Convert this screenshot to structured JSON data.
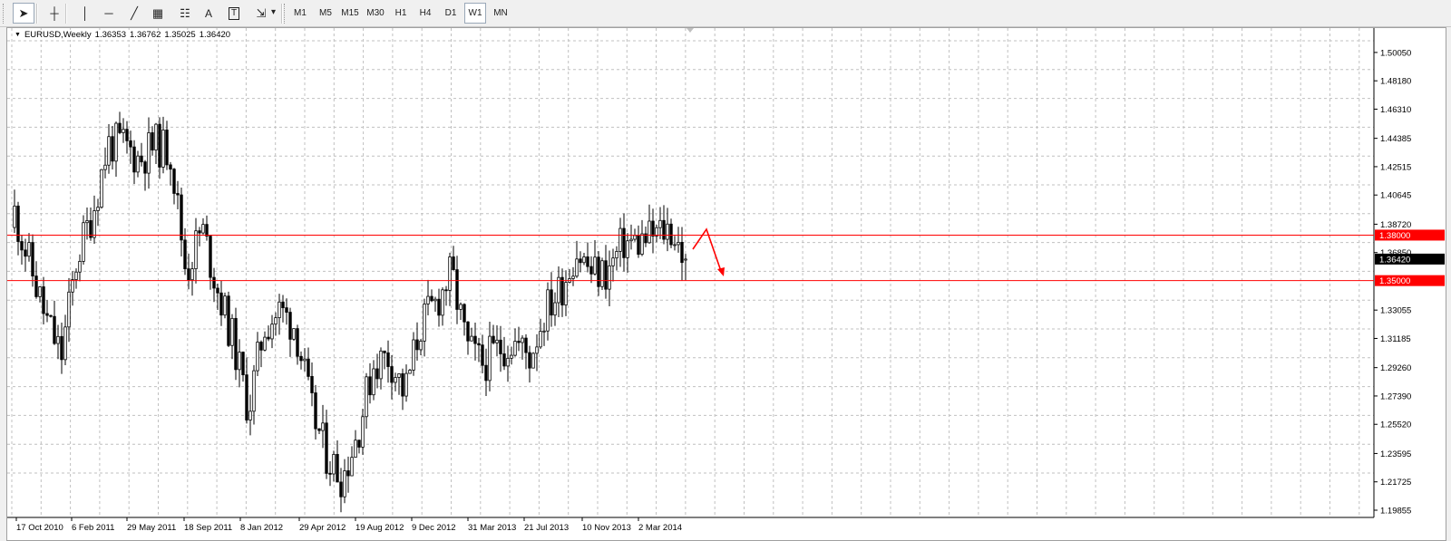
{
  "toolbar": {
    "tools": [
      {
        "name": "cursor-tool",
        "icon": "arrow-cursor-icon",
        "glyph": "➤"
      },
      {
        "name": "crosshair-tool",
        "icon": "crosshair-icon",
        "glyph": "┼"
      },
      {
        "name": "vertical-line-tool",
        "icon": "vertical-line-icon",
        "glyph": "│"
      },
      {
        "name": "horizontal-line-tool",
        "icon": "horizontal-line-icon",
        "glyph": "─"
      },
      {
        "name": "trendline-tool",
        "icon": "trendline-icon",
        "glyph": "╱"
      },
      {
        "name": "equidistant-channel-tool",
        "icon": "channel-icon",
        "glyph": "▦"
      },
      {
        "name": "fibonacci-tool",
        "icon": "fibonacci-icon",
        "glyph": "☷"
      },
      {
        "name": "text-tool",
        "icon": "text-icon",
        "glyph": "A"
      },
      {
        "name": "text-label-tool",
        "icon": "text-label-icon",
        "glyph": "T"
      },
      {
        "name": "arrows-tool",
        "icon": "arrow-shapes-icon",
        "glyph": "⇲"
      }
    ],
    "timeframes": [
      "M1",
      "M5",
      "M15",
      "M30",
      "H1",
      "H4",
      "D1",
      "W1",
      "MN"
    ],
    "active_timeframe": "W1"
  },
  "chart": {
    "symbol": "EURUSD,Weekly",
    "open": "1.36353",
    "high": "1.36762",
    "low": "1.35025",
    "close": "1.36420",
    "price_scale": [
      "1.50050",
      "1.48180",
      "1.46310",
      "1.44385",
      "1.42515",
      "1.40645",
      "1.38720",
      "1.36850",
      "1.33055",
      "1.31185",
      "1.29260",
      "1.27390",
      "1.25520",
      "1.23595",
      "1.21725",
      "1.19855"
    ],
    "date_labels": [
      "17 Oct 2010",
      "6 Feb 2011",
      "29 May 2011",
      "18 Sep 2011",
      "8 Jan 2012",
      "29 Apr 2012",
      "19 Aug 2012",
      "9 Dec 2012",
      "31 Mar 2013",
      "21 Jul 2013",
      "10 Nov 2013",
      "2 Mar 2014"
    ],
    "hlines": [
      {
        "price": 1.38,
        "label": "1.38000",
        "color": "#ff0000"
      },
      {
        "price": 1.35,
        "label": "1.35000",
        "color": "#ff0000"
      }
    ],
    "current_price_label": "1.36420",
    "colors": {
      "candle": "#000000",
      "grid": "#c0c0c0",
      "line": "#ff0000",
      "arrow": "#ff0000"
    }
  },
  "chart_data": {
    "type": "candlestick",
    "ylim": [
      1.19855,
      1.5082
    ],
    "x": [
      "Oct 2010",
      "Nov 2010",
      "Dec 2010",
      "Jan 2011",
      "Feb 2011",
      "Mar 2011",
      "Apr 2011",
      "May 2011",
      "Jun 2011",
      "Jul 2011",
      "Aug 2011",
      "Sep 2011",
      "Oct 2011",
      "Nov 2011",
      "Dec 2011",
      "Jan 2012",
      "Feb 2012",
      "Mar 2012",
      "Apr 2012",
      "May 2012",
      "Jun 2012",
      "Jul 2012",
      "Aug 2012",
      "Sep 2012",
      "Oct 2012",
      "Nov 2012",
      "Dec 2012",
      "Jan 2013",
      "Feb 2013",
      "Mar 2013",
      "Apr 2013",
      "May 2013",
      "Jun 2013",
      "Jul 2013",
      "Aug 2013",
      "Sep 2013",
      "Oct 2013",
      "Nov 2013",
      "Dec 2013",
      "Jan 2014",
      "Feb 2014",
      "Mar 2014",
      "Apr 2014",
      "May 2014"
    ],
    "close": [
      1.395,
      1.36,
      1.325,
      1.3,
      1.365,
      1.395,
      1.44,
      1.44,
      1.43,
      1.44,
      1.435,
      1.355,
      1.385,
      1.345,
      1.31,
      1.265,
      1.32,
      1.33,
      1.32,
      1.265,
      1.235,
      1.22,
      1.25,
      1.295,
      1.3,
      1.275,
      1.32,
      1.335,
      1.355,
      1.305,
      1.295,
      1.305,
      1.31,
      1.3,
      1.33,
      1.345,
      1.37,
      1.355,
      1.355,
      1.375,
      1.375,
      1.38,
      1.385,
      1.3642
    ],
    "annotations": [
      "horizontal line at 1.38000",
      "horizontal line at 1.35000",
      "red arrow up then down"
    ]
  }
}
